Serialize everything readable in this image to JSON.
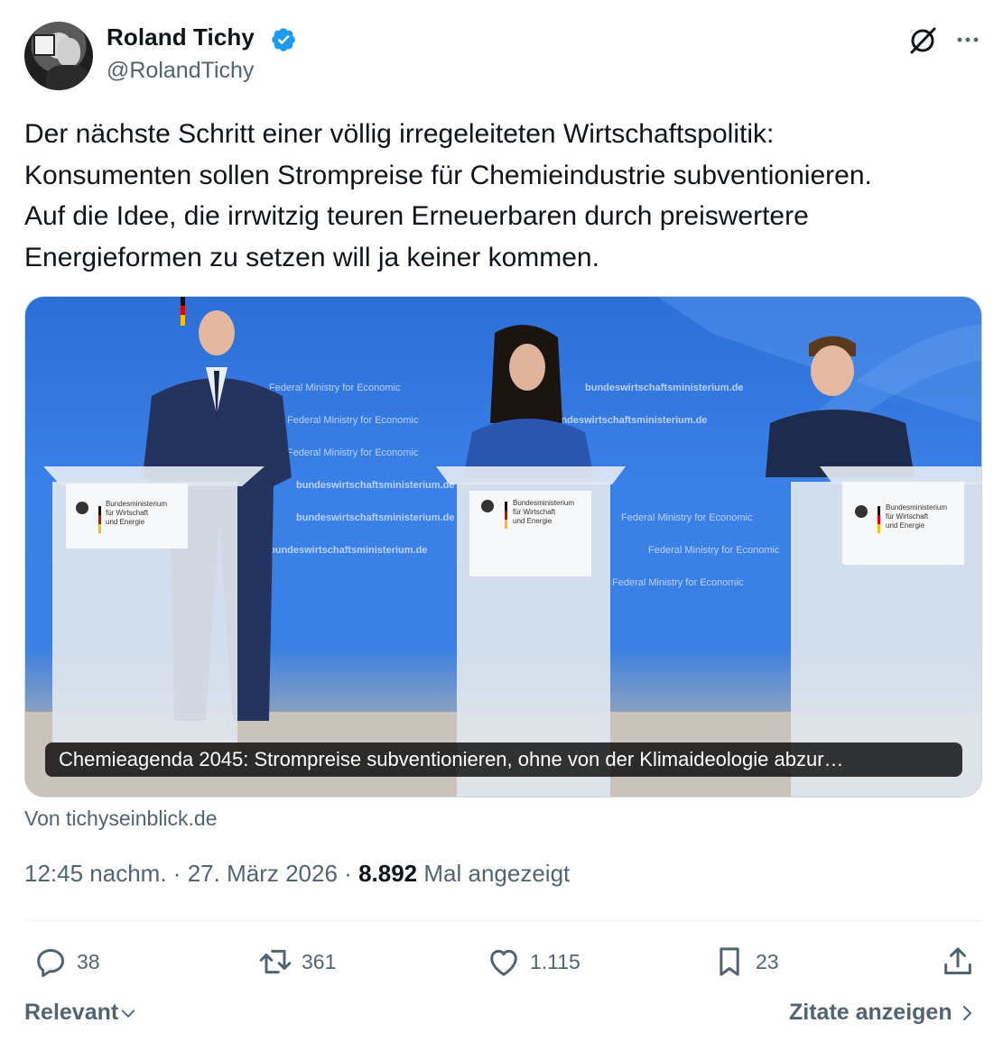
{
  "author": {
    "name": "Roland Tichy",
    "handle": "@RolandTichy"
  },
  "tweet": {
    "text": "Der nächste Schritt einer völlig irregeleiteten Wirtschaftspolitik:\nKonsumenten sollen Strompreise für Chemieindustrie subventionieren.\nAuf die Idee, die irrwitzig teuren Erneuerbaren durch preiswertere\nEnergieformen zu setzen will ja keiner kommen."
  },
  "media": {
    "backdrop_line_1": "Federal Ministry for Economic",
    "backdrop_line_2": "bundeswirtschaftsministerium.de",
    "lectern_label_1": "Bundesministerium",
    "lectern_label_2": "für Wirtschaft",
    "lectern_label_3": "und Energie",
    "caption": "Chemieagenda 2045: Strompreise subventionieren, ohne von der Klimaideologie abzur…",
    "source": "Von tichyseinblick.de"
  },
  "meta": {
    "time": "12:45 nachm.",
    "separator": "·",
    "date": "27. März 2026",
    "views": "8.892",
    "views_label": "Mal angezeigt"
  },
  "actions": {
    "replies": "38",
    "reposts": "361",
    "likes": "1.115",
    "bookmarks": "23"
  },
  "footer": {
    "sort_label": "Relevant",
    "quotes_label": "Zitate anzeigen"
  },
  "colors": {
    "verified": "#1d9bf0",
    "secondary_text": "#536471",
    "primary_text": "#0f1419",
    "backdrop_blue": "#3a80e6"
  }
}
